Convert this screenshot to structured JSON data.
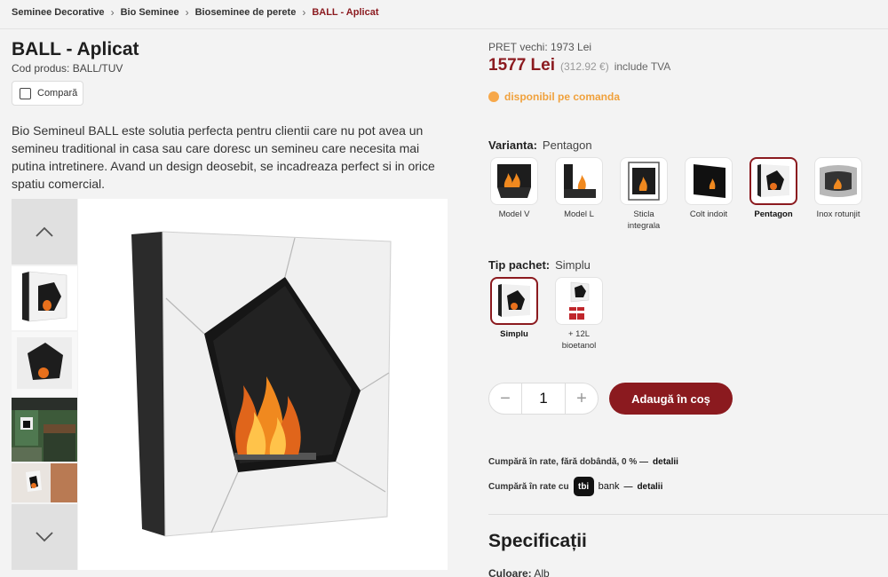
{
  "breadcrumb": {
    "items": [
      "Seminee Decorative",
      "Bio Seminee",
      "Bioseminee de perete"
    ],
    "current": "BALL - Aplicat"
  },
  "product": {
    "title": "BALL - Aplicat",
    "code": "Cod produs: BALL/TUV",
    "compare_label": "Compară",
    "description": "Bio Semineul BALL este solutia perfecta pentru clientii care nu pot avea un semineu traditional in casa sau care doresc un semineu care necesita mai putina intretinere. Avand un design deosebit, se incadreaza perfect si in orice spatiu comercial."
  },
  "pricing": {
    "old_price": "PREȚ vechi: 1973 Lei",
    "price": "1577 Lei",
    "price_eur": "(312.92 €)",
    "tva": "include TVA",
    "availability": "disponibil pe comanda",
    "availability_color": "#f7a84a"
  },
  "variant": {
    "label": "Varianta:",
    "selected": "Pentagon",
    "options": [
      "Model V",
      "Model L",
      "Sticla integrala",
      "Colt indoit",
      "Pentagon",
      "Inox rotunjit"
    ]
  },
  "package": {
    "label": "Tip pachet:",
    "selected": "Simplu",
    "options": [
      "Simplu",
      "+ 12L bioetanol"
    ]
  },
  "cart": {
    "minus": "−",
    "quantity": "1",
    "plus": "+",
    "add_label": "Adaugă în coș",
    "accent": "#8b1a1f"
  },
  "installments": {
    "line1_text": "Cumpără în rate, fără dobândă, 0 % —",
    "line1_link": "detalii",
    "line2_text": "Cumpără în rate cu",
    "tbi_logo": "tbi",
    "bank_word": "bank",
    "dash": "—",
    "line2_link": "detalii"
  },
  "specs": {
    "title": "Specificații",
    "row_label": "Culoare:",
    "row_value": "Alb"
  },
  "icons": [
    "chevron-right-icon",
    "checkbox-icon",
    "chevron-up-icon",
    "chevron-down-icon",
    "availability-dot-icon"
  ]
}
